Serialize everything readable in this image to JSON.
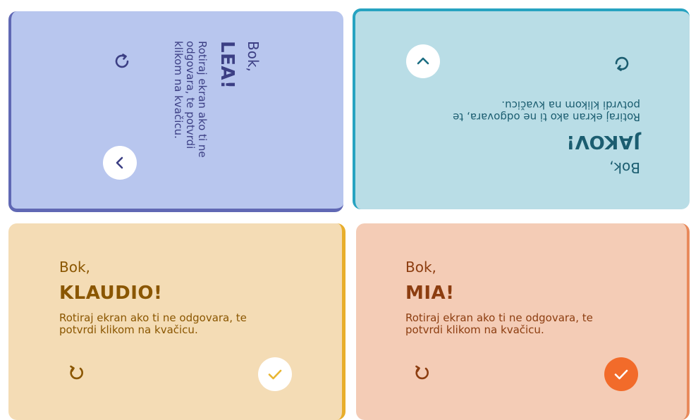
{
  "cards": [
    {
      "greeting": "Bok,",
      "name": "LEA!",
      "message": "Rotiraj ekran ako ti ne odgovara, te potvrdi klikom na kvačicu."
    },
    {
      "greeting": "Bok,",
      "name": "JAKOV!",
      "message": "Rotiraj ekran ako ti ne odgovara, te potvrdi klikom na kvačicu."
    },
    {
      "greeting": "Bok,",
      "name": "KLAUDIO!",
      "message": "Rotiraj ekran ako ti ne odgovara, te potvrdi klikom na kvačicu."
    },
    {
      "greeting": "Bok,",
      "name": "MIA!",
      "message": "Rotiraj ekran ako ti ne odgovara, te potvrdi klikom na kvačicu."
    }
  ],
  "icons": {
    "rotate": "rotate-icon",
    "check": "checkmark-icon",
    "chevron": "chevron-icon"
  },
  "colors": {
    "lea_bg": "#b8c6ee",
    "lea_accent": "#6068b4",
    "jakov_bg": "#b9dde6",
    "jakov_accent": "#27a3c1",
    "klaudio_bg": "#f4dcb5",
    "klaudio_accent": "#e8ae2c",
    "mia_bg": "#f4ccb6",
    "mia_accent": "#f26b2a"
  }
}
